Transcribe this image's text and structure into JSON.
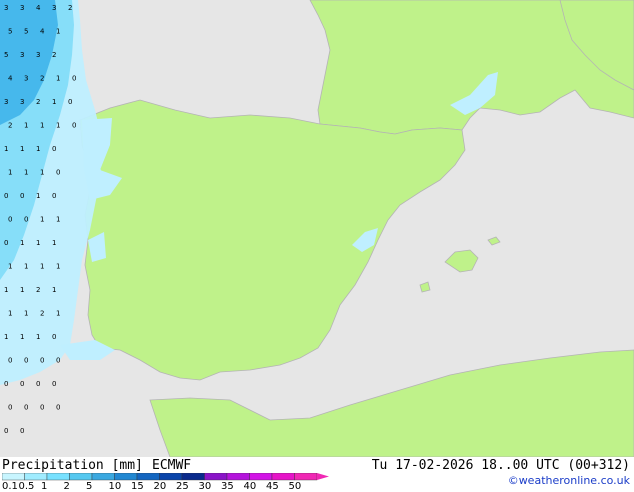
{
  "footer": {
    "title": "Precipitation [mm]",
    "model": "ECMWF",
    "datetime": "Tu 17-02-2026 18..00 UTC (00+312)",
    "credit": "©weatheronline.co.uk"
  },
  "legend": {
    "labels": [
      "0.1",
      "0.5",
      "1",
      "2",
      "5",
      "10",
      "15",
      "20",
      "25",
      "30",
      "35",
      "40",
      "45",
      "50"
    ],
    "colors": [
      "#c8f5ff",
      "#a0ecff",
      "#78e1ff",
      "#55c8f0",
      "#3aa8e0",
      "#2288d2",
      "#1466c0",
      "#0a44aa",
      "#0a2a8c",
      "#8a14c8",
      "#b414dc",
      "#d214e6",
      "#e614c8",
      "#f028b4"
    ]
  },
  "map_colors": {
    "land": "#bff28a",
    "sea": "#e6e6e6",
    "border": "#b4b4b4",
    "precip_light": "#bfefff",
    "precip_mid": "#7fdcf8",
    "precip_heavy": "#46b8ec"
  },
  "grid_values": [
    [
      "3",
      "3",
      "4",
      "3",
      "2"
    ],
    [
      "5",
      "5",
      "4",
      "1"
    ],
    [
      "5",
      "3",
      "3",
      "2"
    ],
    [
      "4",
      "3",
      "2",
      "1",
      "0"
    ],
    [
      "3",
      "3",
      "2",
      "1",
      "0"
    ],
    [
      "2",
      "1",
      "1",
      "1",
      "0"
    ],
    [
      "1",
      "1",
      "1",
      "0"
    ],
    [
      "1",
      "1",
      "1",
      "0"
    ],
    [
      "0",
      "0",
      "1",
      "0"
    ],
    [
      "0",
      "0",
      "1",
      "1"
    ],
    [
      "0",
      "1",
      "1",
      "1"
    ],
    [
      "1",
      "1",
      "1",
      "1"
    ],
    [
      "1",
      "1",
      "2",
      "1"
    ],
    [
      "1",
      "1",
      "2",
      "1"
    ],
    [
      "1",
      "1",
      "1",
      "0"
    ],
    [
      "0",
      "0",
      "0",
      "0"
    ],
    [
      "0",
      "0",
      "0",
      "0"
    ],
    [
      "0",
      "0",
      "0",
      "0"
    ],
    [
      "0",
      "0"
    ]
  ]
}
